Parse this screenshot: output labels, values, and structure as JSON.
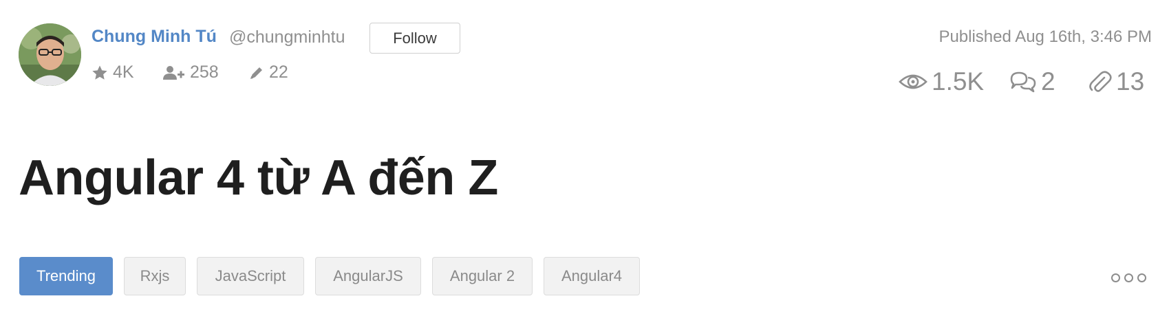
{
  "author": {
    "name": "Chung Minh Tú",
    "handle": "@chungminhtu",
    "follow_label": "Follow",
    "stats": {
      "reputation": "4K",
      "followers": "258",
      "posts": "22"
    }
  },
  "post": {
    "published": "Published Aug 16th, 3:46 PM",
    "views": "1.5K",
    "comments": "2",
    "clips": "13",
    "title": "Angular 4 từ A đến Z"
  },
  "tags": [
    {
      "label": "Trending",
      "active": true
    },
    {
      "label": "Rxjs",
      "active": false
    },
    {
      "label": "JavaScript",
      "active": false
    },
    {
      "label": "AngularJS",
      "active": false
    },
    {
      "label": "Angular 2",
      "active": false
    },
    {
      "label": "Angular4",
      "active": false
    }
  ],
  "colors": {
    "accent": "#5387c6",
    "tag_active_bg": "#5a8ccb",
    "muted_text": "#8f8f8f",
    "title_text": "#1f1f1f"
  },
  "icons": {
    "reputation": "star-icon",
    "followers": "user-plus-icon",
    "posts": "pencil-icon",
    "views": "eye-icon",
    "comments": "comments-icon",
    "clips": "paperclip-icon",
    "more": "more-dots-icon"
  }
}
